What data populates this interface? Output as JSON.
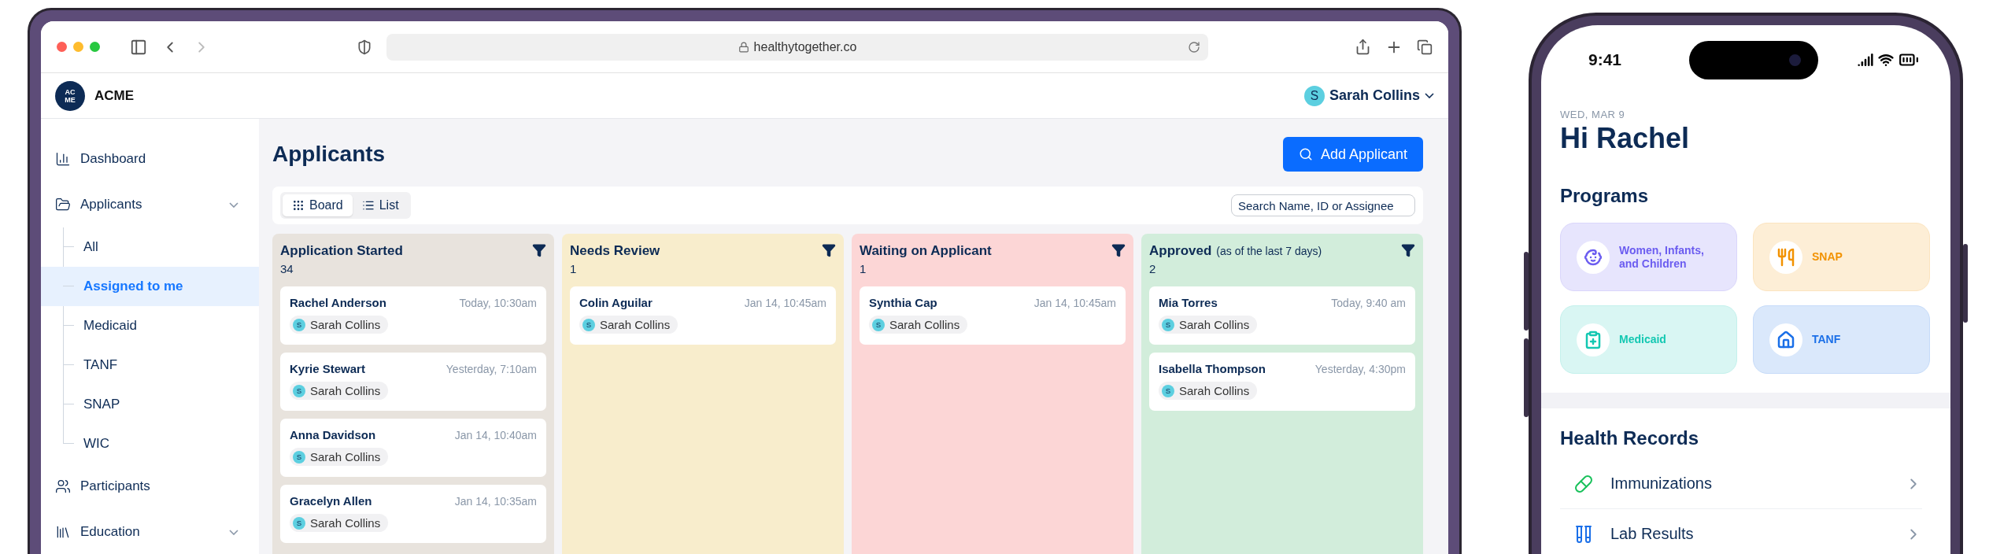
{
  "browser": {
    "url": "healthytogether.co"
  },
  "app": {
    "logo_lines": [
      "AC",
      "ME"
    ],
    "brand": "ACME",
    "user": {
      "initial": "S",
      "name": "Sarah Collins"
    }
  },
  "sidebar": {
    "items": [
      {
        "label": "Dashboard",
        "selected": false
      },
      {
        "label": "Applicants",
        "selected": false,
        "collapsible": true,
        "children": [
          {
            "label": "All",
            "selected": false
          },
          {
            "label": "Assigned to me",
            "selected": true
          },
          {
            "label": "Medicaid",
            "selected": false
          },
          {
            "label": "TANF",
            "selected": false
          },
          {
            "label": "SNAP",
            "selected": false
          },
          {
            "label": "WIC",
            "selected": false
          }
        ]
      },
      {
        "label": "Participants",
        "selected": false
      },
      {
        "label": "Education",
        "selected": false,
        "collapsible": true
      }
    ]
  },
  "page": {
    "title": "Applicants",
    "add_button": "Add Applicant",
    "views": [
      {
        "label": "Board",
        "selected": true
      },
      {
        "label": "List",
        "selected": false
      }
    ],
    "search": {
      "placeholder": "Search Name, ID or Assignee"
    }
  },
  "columns": [
    {
      "title": "Application Started",
      "count": "34",
      "color": "#e8e3dd",
      "cards": [
        {
          "name": "Rachel Anderson",
          "time": "Today, 10:30am",
          "assignee": {
            "initial": "S",
            "name": "Sarah Collins"
          }
        },
        {
          "name": "Kyrie Stewart",
          "time": "Yesterday, 7:10am",
          "assignee": {
            "initial": "S",
            "name": "Sarah Collins"
          }
        },
        {
          "name": "Anna Davidson",
          "time": "Jan 14, 10:40am",
          "assignee": {
            "initial": "S",
            "name": "Sarah Collins"
          }
        },
        {
          "name": "Gracelyn Allen",
          "time": "Jan 14, 10:35am",
          "assignee": {
            "initial": "S",
            "name": "Sarah Collins"
          }
        }
      ]
    },
    {
      "title": "Needs Review",
      "count": "1",
      "color": "#f8edcc",
      "cards": [
        {
          "name": "Colin Aguilar",
          "time": "Jan 14, 10:45am",
          "assignee": {
            "initial": "S",
            "name": "Sarah Collins"
          }
        }
      ]
    },
    {
      "title": "Waiting on Applicant",
      "count": "1",
      "color": "#fcd6d6",
      "cards": [
        {
          "name": "Synthia Cap",
          "time": "Jan 14, 10:45am",
          "assignee": {
            "initial": "S",
            "name": "Sarah Collins"
          }
        }
      ]
    },
    {
      "title": "Approved",
      "note": "(as of the last 7 days)",
      "count": "2",
      "color": "#d2eddb",
      "cards": [
        {
          "name": "Mia Torres",
          "time": "Today, 9:40 am",
          "assignee": {
            "initial": "S",
            "name": "Sarah Collins"
          }
        },
        {
          "name": "Isabella Thompson",
          "time": "Yesterday, 4:30pm",
          "assignee": {
            "initial": "S",
            "name": "Sarah Collins"
          }
        }
      ]
    }
  ],
  "phone": {
    "time": "9:41",
    "date": "WED, MAR 9",
    "greeting": "Hi Rachel",
    "programs_title": "Programs",
    "programs": [
      {
        "label": "Women, Infants, and Children",
        "color": "#6b5cf0"
      },
      {
        "label": "SNAP",
        "color": "#f29200"
      },
      {
        "label": "Medicaid",
        "color": "#14c8b2"
      },
      {
        "label": "TANF",
        "color": "#1a6fe8"
      }
    ],
    "records_title": "Health Records",
    "records": [
      {
        "label": "Immunizations"
      },
      {
        "label": "Lab Results"
      }
    ]
  }
}
